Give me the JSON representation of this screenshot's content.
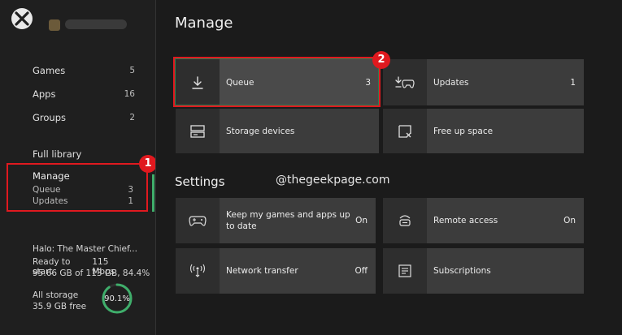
{
  "sidebar": {
    "items": [
      {
        "label": "Games",
        "count": "5"
      },
      {
        "label": "Apps",
        "count": "16"
      },
      {
        "label": "Groups",
        "count": "2"
      }
    ],
    "full_library": "Full library",
    "manage": {
      "label": "Manage",
      "queue_label": "Queue",
      "queue_count": "3",
      "updates_label": "Updates",
      "updates_count": "1"
    },
    "download": {
      "title": "Halo: The Master Chief...",
      "status": "Ready to start",
      "speed": "115 Mbps",
      "progress_text": "95.66 GB of 113 GB, 84.4%"
    },
    "storage": {
      "label": "All storage",
      "free": "35.9 GB free",
      "percent_text": "90.1%",
      "percent_value": 0.901
    }
  },
  "main": {
    "title": "Manage",
    "tiles": [
      {
        "label": "Queue",
        "value": "3",
        "icon": "download-icon"
      },
      {
        "label": "Updates",
        "value": "1",
        "icon": "update-controller-icon"
      },
      {
        "label": "Storage devices",
        "value": "",
        "icon": "storage-icon"
      },
      {
        "label": "Free up space",
        "value": "",
        "icon": "free-space-icon"
      }
    ],
    "settings_title": "Settings",
    "settings_tiles": [
      {
        "label_line1": "Keep my games and apps up",
        "label_line2": "to date",
        "value": "On",
        "icon": "controller-update-icon"
      },
      {
        "label": "Remote access",
        "value": "On",
        "icon": "remote-access-icon"
      },
      {
        "label": "Network transfer",
        "value": "Off",
        "icon": "network-transfer-icon"
      },
      {
        "label": "Subscriptions",
        "value": "",
        "icon": "subscriptions-icon"
      }
    ]
  },
  "annotations": {
    "badge1": "1",
    "badge2": "2",
    "watermark": "@thegeekpage.com"
  },
  "colors": {
    "highlight_red": "#e0191f",
    "active_green": "#3fae6b",
    "tile_bg": "#3c3c3c",
    "icon_bg": "#2e2e2e"
  }
}
